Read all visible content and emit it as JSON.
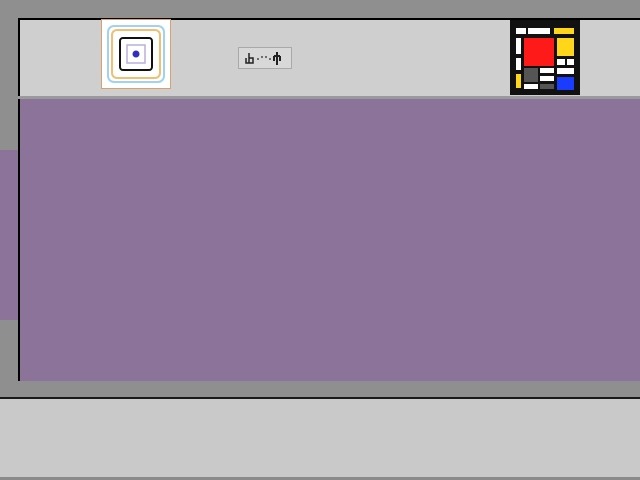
{
  "toolbar": {
    "tools": [
      {
        "name": "target",
        "icon": "target-icon",
        "selected": true
      },
      {
        "name": "glyph",
        "icon": "figure-dots-icon"
      },
      {
        "name": "mondrian",
        "icon": "mondrian-grid-icon"
      }
    ]
  },
  "colors": {
    "background": "#888888",
    "toolbar": "#cfcfcf",
    "canvas": "#8c7399",
    "bottom_panel": "#c9c9c9",
    "mondrian_red": "#ff1a1a",
    "mondrian_yellow": "#ffd61a",
    "mondrian_blue": "#1a3cff"
  }
}
